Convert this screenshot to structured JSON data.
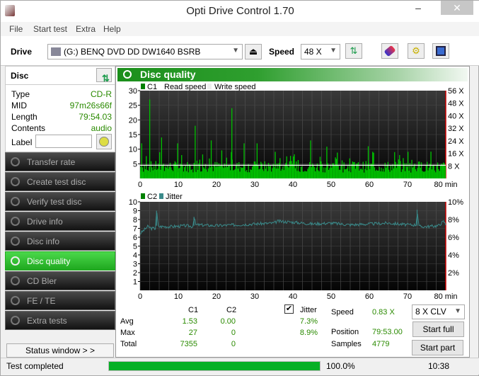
{
  "window": {
    "title": "Opti Drive Control 1.70",
    "min": "‒",
    "max": "☐",
    "close": "✕"
  },
  "menu": [
    "File",
    "Start test",
    "Extra",
    "Help"
  ],
  "toolbar": {
    "drive_label": "Drive",
    "drive_value": "(G:)  BENQ DVD DD DW1640 BSRB",
    "speed_label": "Speed",
    "speed_value": "48 X"
  },
  "disc": {
    "title": "Disc",
    "rows": [
      {
        "k": "Type",
        "v": "CD-R"
      },
      {
        "k": "MID",
        "v": "97m26s66f"
      },
      {
        "k": "Length",
        "v": "79:54.03"
      },
      {
        "k": "Contents",
        "v": "audio"
      }
    ],
    "label_label": "Label",
    "label_value": ""
  },
  "nav": [
    {
      "label": "Transfer rate"
    },
    {
      "label": "Create test disc"
    },
    {
      "label": "Verify test disc"
    },
    {
      "label": "Drive info"
    },
    {
      "label": "Disc info"
    },
    {
      "label": "Disc quality",
      "active": true
    },
    {
      "label": "CD Bler"
    },
    {
      "label": "FE / TE"
    },
    {
      "label": "Extra tests"
    }
  ],
  "status_window": "Status window > >",
  "panel": {
    "title": "Disc quality"
  },
  "legend1": {
    "c1": "C1",
    "read": "Read speed",
    "write": "Write speed"
  },
  "legend2": {
    "c2": "C2",
    "jitter": "Jitter"
  },
  "colors": {
    "c1": "#00c000",
    "jitter": "#3a8a8a",
    "accent": "#1b8f1b",
    "read": "#ffffff"
  },
  "chart_data": [
    {
      "type": "bar",
      "title": "C1 / Read speed",
      "x_range": [
        0,
        80
      ],
      "x_unit": "min",
      "x_ticks": [
        "0",
        "10",
        "20",
        "30",
        "40",
        "50",
        "60",
        "70",
        "80"
      ],
      "y_range": [
        0,
        30
      ],
      "y_ticks": [
        "5",
        "10",
        "15",
        "20",
        "25",
        "30"
      ],
      "y2_range": [
        0,
        56
      ],
      "y2_ticks": [
        "8 X",
        "16 X",
        "24 X",
        "32 X",
        "40 X",
        "48 X",
        "56 X"
      ],
      "c1_peaks": [
        {
          "x": 0.3,
          "y": 12
        },
        {
          "x": 2.4,
          "y": 27
        },
        {
          "x": 5.5,
          "y": 14
        },
        {
          "x": 9.7,
          "y": 12
        },
        {
          "x": 14.3,
          "y": 18
        },
        {
          "x": 18.5,
          "y": 13
        },
        {
          "x": 23.9,
          "y": 24
        },
        {
          "x": 27.1,
          "y": 12
        },
        {
          "x": 30.5,
          "y": 12
        },
        {
          "x": 44.5,
          "y": 13
        },
        {
          "x": 59.6,
          "y": 11
        },
        {
          "x": 66.5,
          "y": 9
        },
        {
          "x": 67.8,
          "y": 8
        }
      ],
      "c1_baseline": [
        2,
        6
      ],
      "read_speed_x": 8.4
    },
    {
      "type": "line",
      "title": "C2 / Jitter",
      "x_range": [
        0,
        80
      ],
      "x_unit": "min",
      "x_ticks": [
        "0",
        "10",
        "20",
        "30",
        "40",
        "50",
        "60",
        "70",
        "80"
      ],
      "y_range": [
        0,
        10
      ],
      "y_ticks": [
        "1",
        "2",
        "3",
        "4",
        "5",
        "6",
        "7",
        "8",
        "9",
        "10"
      ],
      "y2_ticks": [
        "2%",
        "4%",
        "6%",
        "8%",
        "10%"
      ],
      "jitter_points": [
        [
          0,
          6.4
        ],
        [
          1,
          6.8
        ],
        [
          2,
          7.2
        ],
        [
          3,
          7.0
        ],
        [
          4,
          7.0
        ],
        [
          4.3,
          9.0
        ],
        [
          4.8,
          7.2
        ],
        [
          8,
          7.2
        ],
        [
          12,
          7.3
        ],
        [
          13.8,
          7.2
        ],
        [
          14.1,
          8.3
        ],
        [
          14.6,
          7.4
        ],
        [
          20,
          7.3
        ],
        [
          25,
          7.4
        ],
        [
          30,
          7.5
        ],
        [
          35,
          7.6
        ],
        [
          36,
          7.8
        ],
        [
          40,
          7.7
        ],
        [
          45,
          7.5
        ],
        [
          50,
          7.6
        ],
        [
          55,
          7.4
        ],
        [
          60,
          7.5
        ],
        [
          65,
          7.6
        ],
        [
          70,
          7.4
        ],
        [
          72.3,
          7.4
        ],
        [
          72.5,
          9.1
        ],
        [
          73,
          7.2
        ],
        [
          75,
          7.2
        ],
        [
          78,
          7.3
        ],
        [
          79.5,
          7.8
        ],
        [
          80,
          7.4
        ]
      ],
      "c2_values": "all 0"
    }
  ],
  "stats": {
    "hdr_c1": "C1",
    "hdr_c2": "C2",
    "jitter_label": "Jitter",
    "jitter_checked": true,
    "rows": [
      {
        "k": "Avg",
        "c1": "1.53",
        "c2": "0.00",
        "j": "7.3%"
      },
      {
        "k": "Max",
        "c1": "27",
        "c2": "0",
        "j": "8.9%"
      },
      {
        "k": "Total",
        "c1": "7355",
        "c2": "0",
        "j": ""
      }
    ],
    "speed_label": "Speed",
    "speed_value": "0.83 X",
    "position_label": "Position",
    "position_value": "79:53.00",
    "samples_label": "Samples",
    "samples_value": "4779",
    "mode_value": "8 X CLV",
    "start_full": "Start full",
    "start_part": "Start part"
  },
  "statusbar": {
    "text": "Test completed",
    "progress": 100,
    "progress_text": "100.0%",
    "time": "10:38"
  }
}
